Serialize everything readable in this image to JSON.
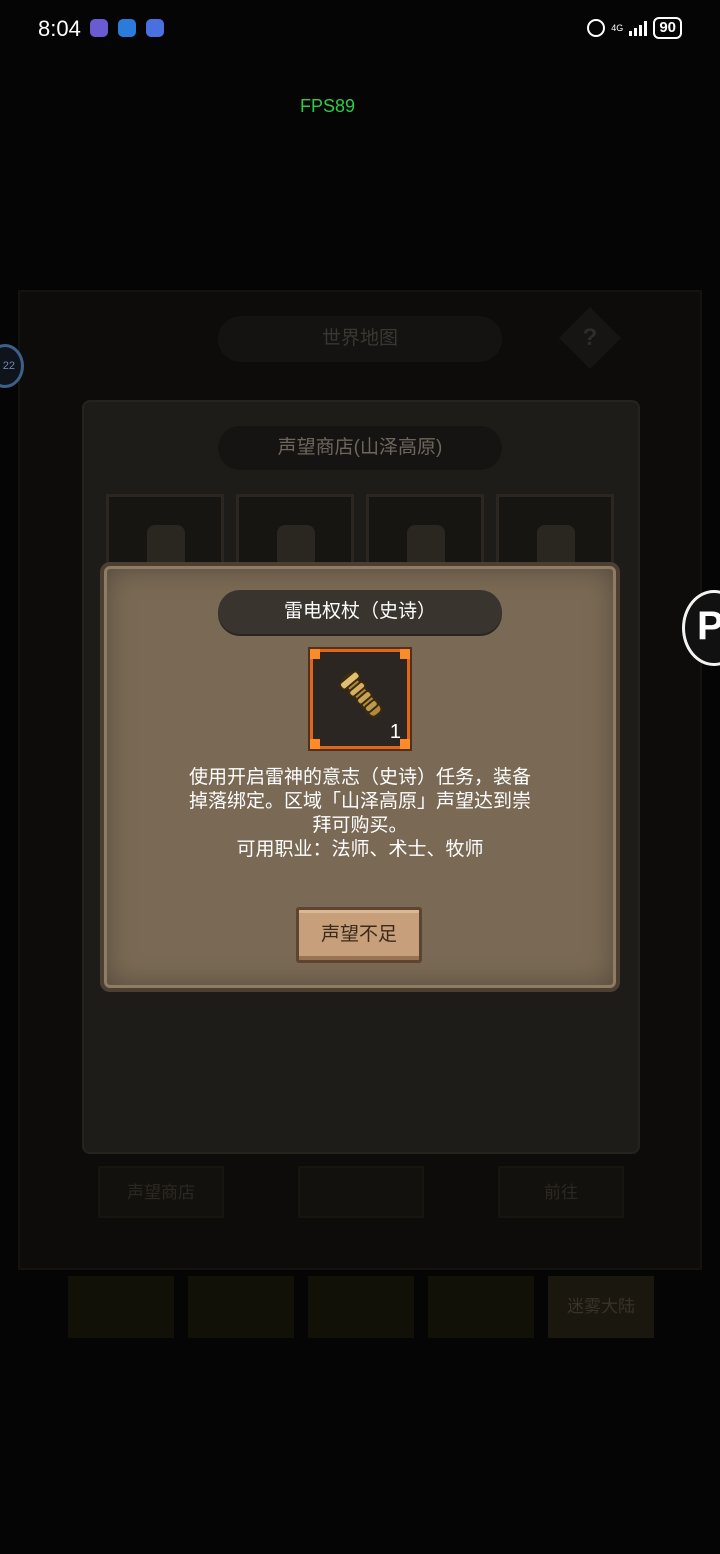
{
  "status_bar": {
    "time": "8:04",
    "network": "4G",
    "battery": "90",
    "app_icons": [
      "app-icon-1",
      "app-icon-2",
      "app-icon-3"
    ],
    "colors": {
      "icon1": "#6b5bd2",
      "icon2": "#2b7bdb",
      "icon3": "#4a6fe0"
    }
  },
  "overlay": {
    "fps": "FPS89"
  },
  "background": {
    "world_map_title": "世界地图",
    "help_symbol": "?",
    "shop_title": "声望商店(山泽高原)",
    "bottom_buttons": [
      "声望商店",
      "",
      "前往"
    ],
    "tabs": [
      "",
      "",
      "",
      "",
      "迷雾大陆"
    ],
    "side_bubble": "22",
    "p_badge": "P"
  },
  "modal": {
    "title": "雷电权杖（史诗）",
    "item": {
      "icon": "scepter-icon",
      "count": "1",
      "rarity_color": "#e2661a"
    },
    "description_lines": [
      "使用开启雷神的意志（史诗）任务，装备",
      "掉落绑定。区域「山泽高原」声望达到崇",
      "拜可购买。"
    ],
    "classes_line": "可用职业：法师、术士、牧师",
    "button_label": "声望不足"
  }
}
